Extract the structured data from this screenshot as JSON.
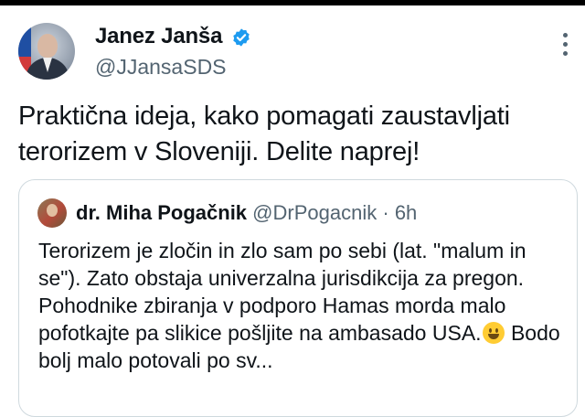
{
  "author": {
    "name": "Janez Janša",
    "handle": "@JJansaSDS",
    "verified_color": "#1d9bf0"
  },
  "tweet": {
    "text": "Praktična ideja, kako pomagati zaustavljati terorizem v Sloveniji. Delite naprej!"
  },
  "quoted_tweet": {
    "author_name": "dr. Miha Pogačnik",
    "handle": "@DrPogacnik",
    "separator": "·",
    "time": "6h",
    "text_before_emoji": "Terorizem je zločin in zlo sam po sebi (lat. \"malum in se\"). Zato obstaja univerzalna jurisdikcija za pregon. Pohodnike zbiranja v podporo Hamas morda malo pofotkajte pa slikice pošljite na ambasado USA.",
    "emoji": "grinning-face",
    "text_after_emoji": " Bodo bolj malo potovali po sv..."
  },
  "icons": {
    "more": "more-options-icon",
    "verified": "verified-badge-icon"
  }
}
